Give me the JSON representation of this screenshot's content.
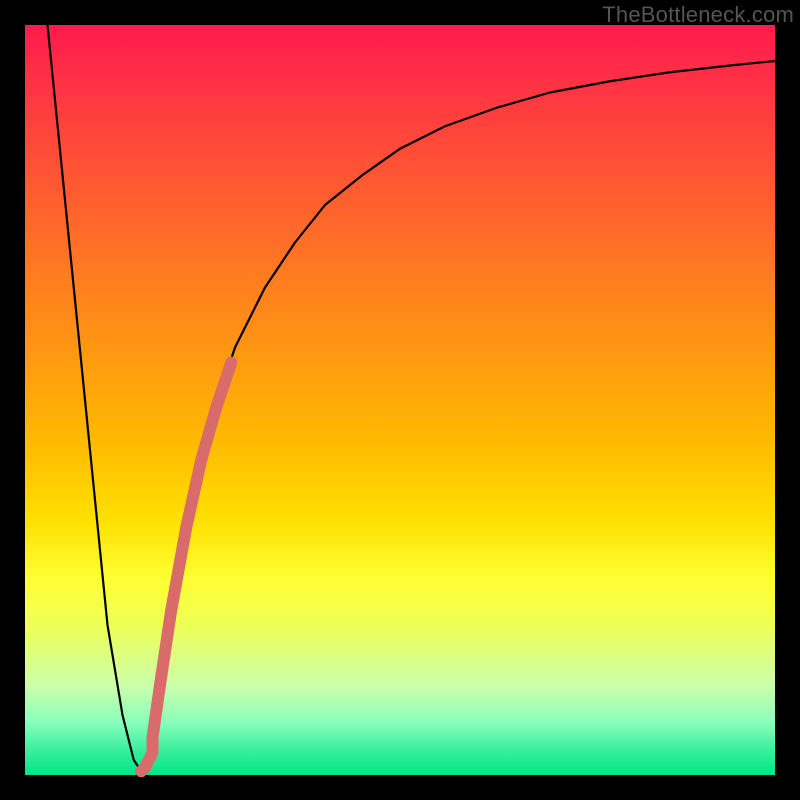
{
  "watermark": "TheBottleneck.com",
  "chart_data": {
    "type": "line",
    "title": "",
    "xlabel": "",
    "ylabel": "",
    "xlim": [
      0,
      100
    ],
    "ylim": [
      0,
      100
    ],
    "series": [
      {
        "name": "main-curve",
        "color": "#000000",
        "width": 2.2,
        "x": [
          3,
          6,
          9,
          11,
          13,
          14.5,
          15.5,
          17,
          19,
          21,
          23,
          25,
          28,
          32,
          36,
          40,
          45,
          50,
          56,
          63,
          70,
          78,
          86,
          94,
          100
        ],
        "y": [
          100,
          70,
          40,
          20,
          8,
          2,
          0.5,
          5,
          18,
          30,
          40,
          48,
          57,
          65,
          71,
          76,
          80,
          83.5,
          86.5,
          89,
          91,
          92.5,
          93.7,
          94.6,
          95.2
        ]
      },
      {
        "name": "highlight-segment",
        "color": "#d96b6b",
        "width": 12,
        "x": [
          15.5,
          16,
          16.5,
          17,
          17,
          18,
          19.5,
          21.5,
          23.5,
          25.5,
          27.5
        ],
        "y": [
          0.5,
          1,
          2,
          3,
          5,
          12,
          22,
          33,
          42,
          49,
          55
        ]
      }
    ]
  }
}
